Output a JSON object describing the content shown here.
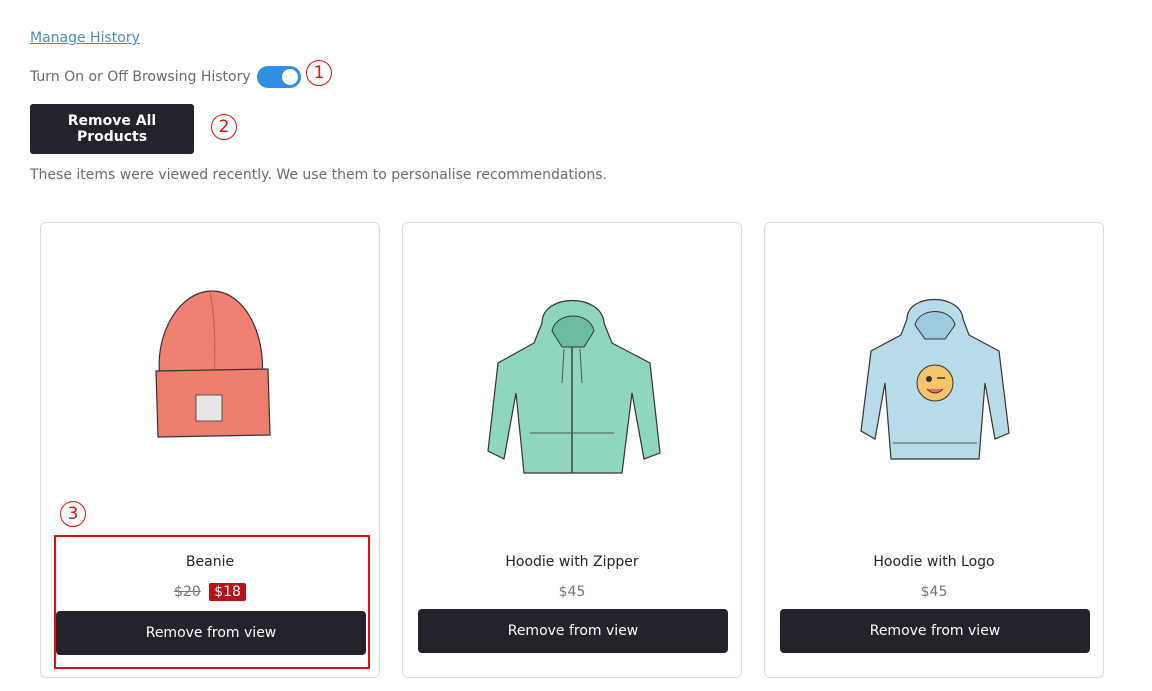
{
  "manage_history": {
    "label": "Manage History"
  },
  "toggle": {
    "label": "Turn On or Off Browsing History",
    "state": "on"
  },
  "remove_all": {
    "label": "Remove All Products"
  },
  "intro_text": "These items were viewed recently. We use them to personalise recommendations.",
  "annotations": {
    "one": "1",
    "two": "2",
    "three": "3"
  },
  "products": [
    {
      "name": "Beanie",
      "price_old": "$20",
      "price_sale": "$18",
      "button": "Remove from view",
      "image_icon": "beanie-image"
    },
    {
      "name": "Hoodie with Zipper",
      "price": "$45",
      "button": "Remove from view",
      "image_icon": "zip-hoodie-image"
    },
    {
      "name": "Hoodie with Logo",
      "price": "$45",
      "button": "Remove from view",
      "image_icon": "logo-hoodie-image"
    }
  ],
  "colors": {
    "toggle_on": "#2f8fe0",
    "button_dark": "#23232b",
    "sale_badge": "#b5121b",
    "annotation_red": "#e01010"
  }
}
